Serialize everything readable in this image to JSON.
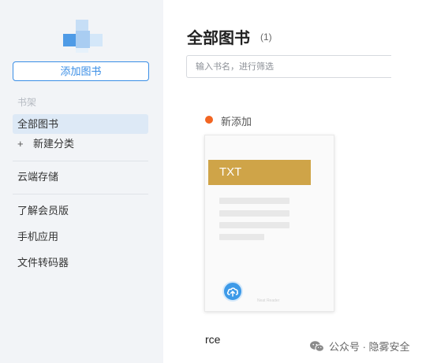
{
  "sidebar": {
    "add_button": "添加图书",
    "section_label": "书架",
    "items": [
      {
        "label": "全部图书"
      },
      {
        "label": "新建分类",
        "prefix": "+"
      },
      {
        "label": "云端存储"
      },
      {
        "label": "了解会员版"
      },
      {
        "label": "手机应用"
      },
      {
        "label": "文件转码器"
      }
    ]
  },
  "main": {
    "title": "全部图书",
    "count": "(1)",
    "search_placeholder": "输入书名，进行筛选",
    "status_label": "新添加",
    "book": {
      "format": "TXT",
      "title": "rce",
      "watermark": "Neat Reader"
    }
  },
  "watermark": {
    "text": "公众号 · 隐雾安全"
  },
  "colors": {
    "accent": "#3a8ee6",
    "active_bg": "#dde9f6",
    "status_dot": "#f26522",
    "book_band": "#cfa448",
    "upload": "#3d9ae8"
  },
  "icons": {
    "logo": "app-logo-icon",
    "upload": "cloud-upload-icon",
    "watermark": "wechat-icon"
  }
}
